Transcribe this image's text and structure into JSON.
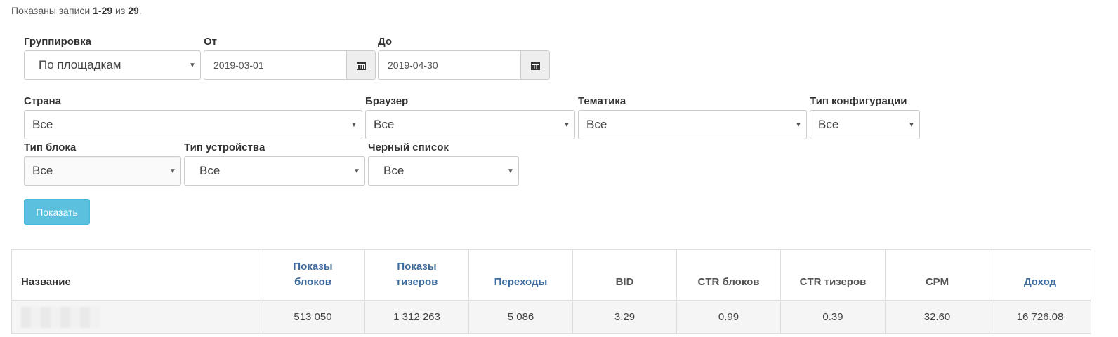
{
  "summary": {
    "prefix": "Показаны записи",
    "range": "1-29",
    "of": "из",
    "total": "29"
  },
  "filters": {
    "grouping": {
      "label": "Группировка",
      "value": "По площадкам"
    },
    "from": {
      "label": "От",
      "value": "2019-03-01"
    },
    "to": {
      "label": "До",
      "value": "2019-04-30"
    },
    "country": {
      "label": "Страна",
      "value": "Все"
    },
    "browser": {
      "label": "Браузер",
      "value": "Все"
    },
    "topic": {
      "label": "Тематика",
      "value": "Все"
    },
    "config_type": {
      "label": "Тип конфигурации",
      "value": "Все"
    },
    "block_type": {
      "label": "Тип блока",
      "value": "Все"
    },
    "device_type": {
      "label": "Тип устройства",
      "value": "Все"
    },
    "blacklist": {
      "label": "Черный список",
      "value": "Все"
    }
  },
  "show_button": "Показать",
  "table": {
    "headers": {
      "name": "Название",
      "block_impressions_1": "Показы",
      "block_impressions_2": "блоков",
      "teaser_impressions_1": "Показы",
      "teaser_impressions_2": "тизеров",
      "clicks": "Переходы",
      "bid": "BID",
      "ctr_blocks": "CTR блоков",
      "ctr_teasers": "CTR тизеров",
      "cpm": "CPM",
      "revenue": "Доход"
    },
    "rows": [
      {
        "block_impressions": "513 050",
        "teaser_impressions": "1 312 263",
        "clicks": "5 086",
        "bid": "3.29",
        "ctr_blocks": "0.99",
        "ctr_teasers": "0.39",
        "cpm": "32.60",
        "revenue": "16 726.08"
      }
    ]
  },
  "colors": {
    "accent_button": "#5bc0de",
    "header_link": "#3e6b9c"
  },
  "icons": {
    "calendar": "calendar-icon",
    "caret": "caret-down-icon"
  }
}
